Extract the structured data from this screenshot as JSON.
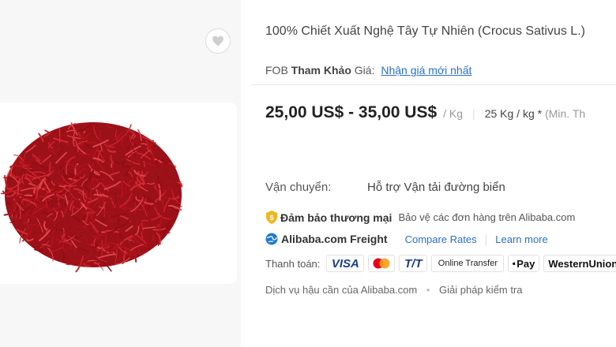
{
  "product": {
    "title": "100% Chiết Xuất Nghệ Tây Tự Nhiên (Crocus Sativus L.)"
  },
  "fob": {
    "prefix": "FOB",
    "ref": "Tham Khảo",
    "price_label": "Giá:",
    "link": "Nhận giá mới nhất"
  },
  "price": {
    "range": "25,00 US$ - 35,00 US$",
    "unit": "/ Kg",
    "moq": "25 Kg / kg *",
    "moq_note": "(Min. Th"
  },
  "shipping": {
    "label": "Vận chuyển:",
    "value": "Hỗ trợ Vận tải đường biển"
  },
  "assurance": {
    "title": "Đảm bảo thương mại",
    "desc": "Bảo vệ các đơn hàng trên Alibaba.com"
  },
  "freight": {
    "title": "Alibaba.com Freight",
    "compare": "Compare Rates",
    "learn": "Learn more"
  },
  "payment": {
    "label": "Thanh toán:",
    "methods": {
      "visa": "VISA",
      "tt": "T/T",
      "online": "Online Transfer",
      "applepay": "Pay",
      "wu": "WesternUnion"
    }
  },
  "services": {
    "logistics": "Dịch vụ hậu cần của Alibaba.com",
    "inspection": "Giải pháp kiểm tra"
  },
  "colors": {
    "link": "#2a6fc9",
    "saffron": "#b5121b",
    "assurance_gold": "#f2b51c",
    "freight_blue": "#1f7ad1"
  }
}
